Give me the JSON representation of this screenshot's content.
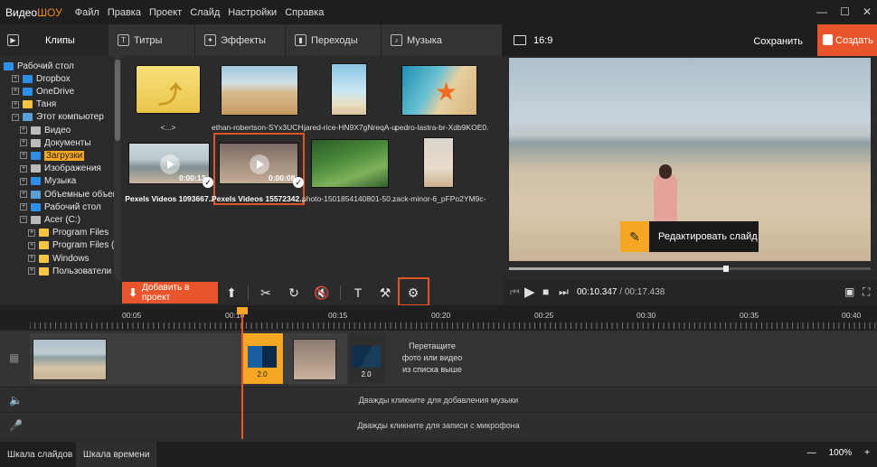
{
  "app": {
    "logo_a": "Видео",
    "logo_b": "ШОУ",
    "menu": [
      "Файл",
      "Правка",
      "Проект",
      "Слайд",
      "Настройки",
      "Справка"
    ]
  },
  "tabs": [
    {
      "label": "Клипы",
      "icon": "play-icon",
      "active": true
    },
    {
      "label": "Титры",
      "icon": "text-icon"
    },
    {
      "label": "Эффекты",
      "icon": "magic-wand-icon"
    },
    {
      "label": "Переходы",
      "icon": "transition-icon"
    },
    {
      "label": "Музыка",
      "icon": "music-icon"
    }
  ],
  "tree": [
    {
      "label": "Рабочий стол",
      "level": 0,
      "color": "#2f8fe8"
    },
    {
      "label": "Dropbox",
      "level": 1,
      "color": "#2f8fe8"
    },
    {
      "label": "OneDrive",
      "level": 1,
      "color": "#2f8fe8"
    },
    {
      "label": "Таня",
      "level": 1,
      "color": "#f5c542"
    },
    {
      "label": "Этот компьютер",
      "level": 1,
      "color": "#5aa0d8",
      "expanded": true
    },
    {
      "label": "Видео",
      "level": 2,
      "color": "#bbbbbb"
    },
    {
      "label": "Документы",
      "level": 2,
      "color": "#bbbbbb"
    },
    {
      "label": "Загрузки",
      "level": 2,
      "color": "#2f8fe8",
      "highlight": true
    },
    {
      "label": "Изображения",
      "level": 2,
      "color": "#bbbbbb"
    },
    {
      "label": "Музыка",
      "level": 2,
      "color": "#2f8fe8"
    },
    {
      "label": "Объемные объект",
      "level": 2,
      "color": "#5aa0d8"
    },
    {
      "label": "Рабочий стол",
      "level": 2,
      "color": "#2f8fe8"
    },
    {
      "label": "Acer (C:)",
      "level": 2,
      "color": "#bbbbbb",
      "expanded": true
    },
    {
      "label": "Program Files",
      "level": 3,
      "color": "#f5c542"
    },
    {
      "label": "Program Files (x",
      "level": 3,
      "color": "#f5c542"
    },
    {
      "label": "Windows",
      "level": 3,
      "color": "#f5c542"
    },
    {
      "label": "Пользователи",
      "level": 3,
      "color": "#f5c542"
    }
  ],
  "files": [
    {
      "caption": "<...>",
      "type": "folder-up"
    },
    {
      "caption": "ethan-robertson-SYx3UCH...",
      "type": "image"
    },
    {
      "caption": "jared-rice-HN9X7gNreqA-u...",
      "type": "image"
    },
    {
      "caption": "pedro-lastra-br-Xdb9KOE0...",
      "type": "image"
    },
    {
      "caption": "Pexels Videos 1093667...",
      "type": "video",
      "duration": "0:00:13",
      "checked": true
    },
    {
      "caption": "Pexels Videos 15572342...",
      "type": "video",
      "duration": "0:00:08",
      "checked": true,
      "selected": true
    },
    {
      "caption": "photo-1501854140801-50...",
      "type": "image"
    },
    {
      "caption": "zack-minor-6_pFPo2YM9c-...",
      "type": "image"
    }
  ],
  "preview": {
    "ratio": "16:9",
    "save_label": "Сохранить",
    "create_label": "Создать",
    "edit_label": "Редактировать слайд",
    "progress": 0.6
  },
  "toolbar": {
    "add_label": "Добавить в проект"
  },
  "player": {
    "current": "00:10.347",
    "separator": " / ",
    "total": "00:17.438"
  },
  "ruler": [
    "00:05",
    "00:10",
    "00:15",
    "00:20",
    "00:25",
    "00:30",
    "00:35",
    "00:40"
  ],
  "timeline": {
    "transition_1": "2.0",
    "transition_2": "2.0",
    "drop_hint_1": "Перетащите",
    "drop_hint_2": "фото или видео",
    "drop_hint_3": "из списка выше",
    "music_hint": "Дважды кликните для добавления музыки",
    "mic_hint": "Дважды кликните для записи с микрофона"
  },
  "bottom": {
    "tab_slides": "Шкала слайдов",
    "tab_timeline": "Шкала времени",
    "zoom": "100%"
  },
  "colors": {
    "accent": "#e8552a",
    "highlight": "#f5a623"
  }
}
